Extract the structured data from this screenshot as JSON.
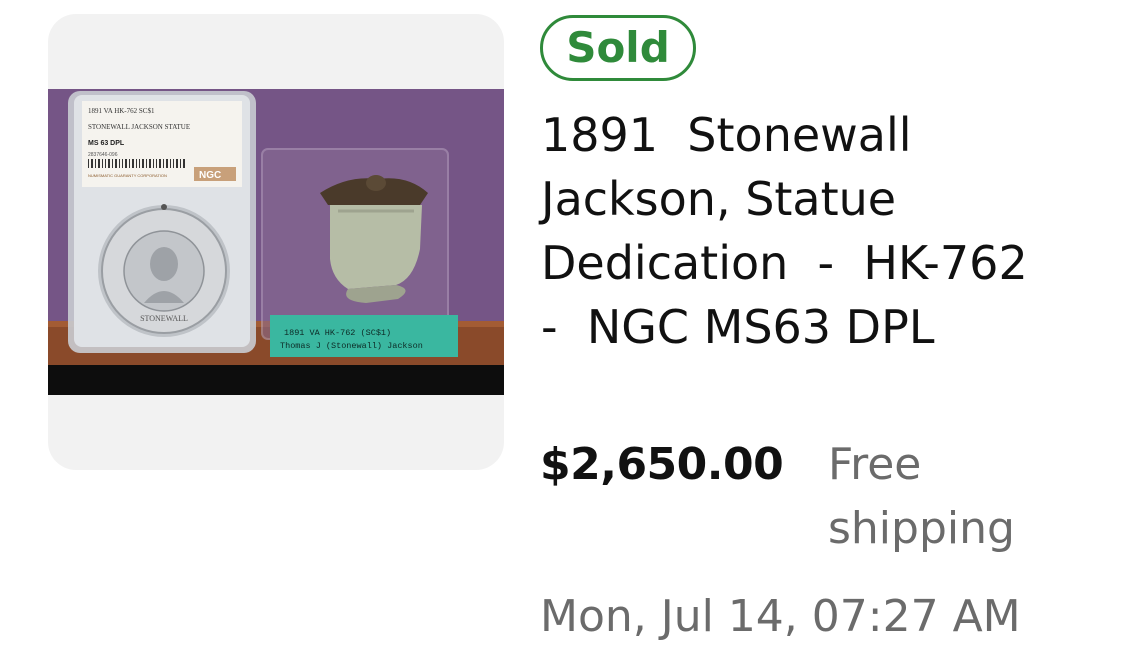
{
  "listing": {
    "status_badge": "Sold",
    "title": "1891  Stonewall Jackson, Statue Dedication  -  HK-762  -  NGC MS63 DPL",
    "price": "$2,650.00",
    "shipping": "Free shipping",
    "sold_date": "Mon, Jul 14, 07:27 AM",
    "status_color": "#2f8a3a"
  },
  "thumbnail": {
    "slab_label": {
      "line1": "1891 VA HK-762 SC$1",
      "line2": "STONEWALL JACKSON STATUE",
      "line3": "MS 63 DPL",
      "serial": "2837646-096",
      "footer": "NUMISMATIC GUARANTY CORPORATION",
      "brand": "NGC"
    },
    "medal_inscription": "STONEWALL",
    "tag": {
      "line1": "1891 VA HK-762 (SC$1)",
      "line2": "Thomas J (Stonewall) Jackson"
    }
  }
}
